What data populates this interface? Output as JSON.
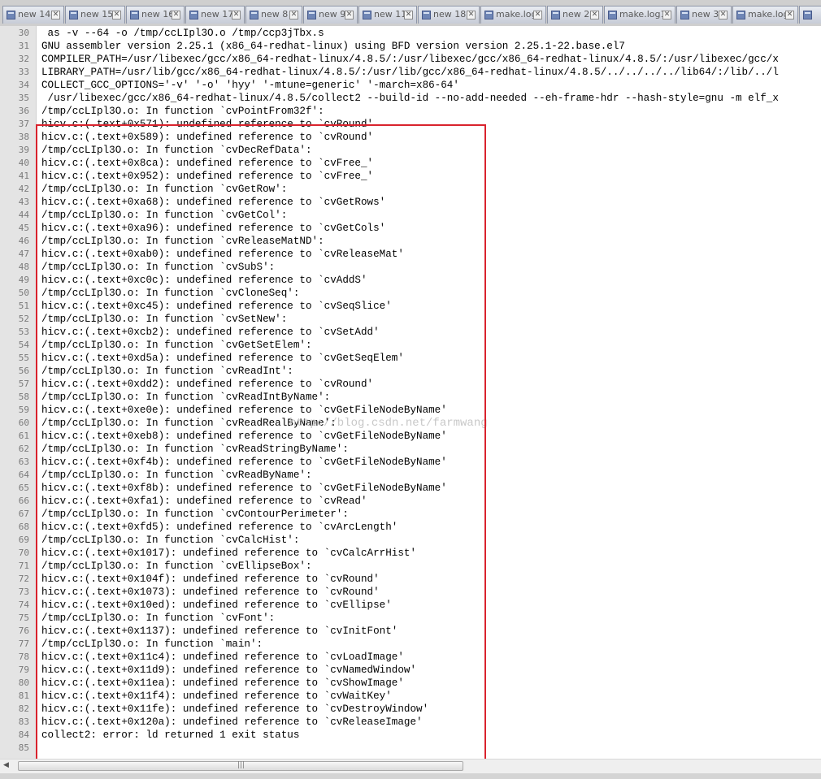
{
  "tabs": [
    {
      "label": "new 14"
    },
    {
      "label": "new 15"
    },
    {
      "label": "new 16"
    },
    {
      "label": "new 17"
    },
    {
      "label": "new 8"
    },
    {
      "label": "new 9"
    },
    {
      "label": "new 11"
    },
    {
      "label": "new 18"
    },
    {
      "label": "make.log"
    },
    {
      "label": "new 2"
    },
    {
      "label": "make.log1"
    },
    {
      "label": "new 3"
    },
    {
      "label": "make.log2"
    }
  ],
  "lines": [
    {
      "n": "30",
      "t": " as -v --64 -o /tmp/ccLIpl3O.o /tmp/ccp3jTbx.s"
    },
    {
      "n": "31",
      "t": "GNU assembler version 2.25.1 (x86_64-redhat-linux) using BFD version version 2.25.1-22.base.el7"
    },
    {
      "n": "32",
      "t": "COMPILER_PATH=/usr/libexec/gcc/x86_64-redhat-linux/4.8.5/:/usr/libexec/gcc/x86_64-redhat-linux/4.8.5/:/usr/libexec/gcc/x"
    },
    {
      "n": "33",
      "t": "LIBRARY_PATH=/usr/lib/gcc/x86_64-redhat-linux/4.8.5/:/usr/lib/gcc/x86_64-redhat-linux/4.8.5/../../../../lib64/:/lib/../l"
    },
    {
      "n": "34",
      "t": "COLLECT_GCC_OPTIONS='-v' '-o' 'hyy' '-mtune=generic' '-march=x86-64'"
    },
    {
      "n": "35",
      "t": " /usr/libexec/gcc/x86_64-redhat-linux/4.8.5/collect2 --build-id --no-add-needed --eh-frame-hdr --hash-style=gnu -m elf_x"
    },
    {
      "n": "36",
      "t": "/tmp/ccLIpl3O.o: In function `cvPointFrom32f':"
    },
    {
      "n": "37",
      "t": "hicv.c:(.text+0x571): undefined reference to `cvRound'"
    },
    {
      "n": "38",
      "t": "hicv.c:(.text+0x589): undefined reference to `cvRound'"
    },
    {
      "n": "39",
      "t": "/tmp/ccLIpl3O.o: In function `cvDecRefData':"
    },
    {
      "n": "40",
      "t": "hicv.c:(.text+0x8ca): undefined reference to `cvFree_'"
    },
    {
      "n": "41",
      "t": "hicv.c:(.text+0x952): undefined reference to `cvFree_'"
    },
    {
      "n": "42",
      "t": "/tmp/ccLIpl3O.o: In function `cvGetRow':"
    },
    {
      "n": "43",
      "t": "hicv.c:(.text+0xa68): undefined reference to `cvGetRows'"
    },
    {
      "n": "44",
      "t": "/tmp/ccLIpl3O.o: In function `cvGetCol':"
    },
    {
      "n": "45",
      "t": "hicv.c:(.text+0xa96): undefined reference to `cvGetCols'"
    },
    {
      "n": "46",
      "t": "/tmp/ccLIpl3O.o: In function `cvReleaseMatND':"
    },
    {
      "n": "47",
      "t": "hicv.c:(.text+0xab0): undefined reference to `cvReleaseMat'"
    },
    {
      "n": "48",
      "t": "/tmp/ccLIpl3O.o: In function `cvSubS':"
    },
    {
      "n": "49",
      "t": "hicv.c:(.text+0xc0c): undefined reference to `cvAddS'"
    },
    {
      "n": "50",
      "t": "/tmp/ccLIpl3O.o: In function `cvCloneSeq':"
    },
    {
      "n": "51",
      "t": "hicv.c:(.text+0xc45): undefined reference to `cvSeqSlice'"
    },
    {
      "n": "52",
      "t": "/tmp/ccLIpl3O.o: In function `cvSetNew':"
    },
    {
      "n": "53",
      "t": "hicv.c:(.text+0xcb2): undefined reference to `cvSetAdd'"
    },
    {
      "n": "54",
      "t": "/tmp/ccLIpl3O.o: In function `cvGetSetElem':"
    },
    {
      "n": "55",
      "t": "hicv.c:(.text+0xd5a): undefined reference to `cvGetSeqElem'"
    },
    {
      "n": "56",
      "t": "/tmp/ccLIpl3O.o: In function `cvReadInt':"
    },
    {
      "n": "57",
      "t": "hicv.c:(.text+0xdd2): undefined reference to `cvRound'"
    },
    {
      "n": "58",
      "t": "/tmp/ccLIpl3O.o: In function `cvReadIntByName':"
    },
    {
      "n": "59",
      "t": "hicv.c:(.text+0xe0e): undefined reference to `cvGetFileNodeByName'"
    },
    {
      "n": "60",
      "t": "/tmp/ccLIpl3O.o: In function `cvReadRealByName':"
    },
    {
      "n": "61",
      "t": "hicv.c:(.text+0xeb8): undefined reference to `cvGetFileNodeByName'"
    },
    {
      "n": "62",
      "t": "/tmp/ccLIpl3O.o: In function `cvReadStringByName':"
    },
    {
      "n": "63",
      "t": "hicv.c:(.text+0xf4b): undefined reference to `cvGetFileNodeByName'"
    },
    {
      "n": "64",
      "t": "/tmp/ccLIpl3O.o: In function `cvReadByName':"
    },
    {
      "n": "65",
      "t": "hicv.c:(.text+0xf8b): undefined reference to `cvGetFileNodeByName'"
    },
    {
      "n": "66",
      "t": "hicv.c:(.text+0xfa1): undefined reference to `cvRead'"
    },
    {
      "n": "67",
      "t": "/tmp/ccLIpl3O.o: In function `cvContourPerimeter':"
    },
    {
      "n": "68",
      "t": "hicv.c:(.text+0xfd5): undefined reference to `cvArcLength'"
    },
    {
      "n": "69",
      "t": "/tmp/ccLIpl3O.o: In function `cvCalcHist':"
    },
    {
      "n": "70",
      "t": "hicv.c:(.text+0x1017): undefined reference to `cvCalcArrHist'"
    },
    {
      "n": "71",
      "t": "/tmp/ccLIpl3O.o: In function `cvEllipseBox':"
    },
    {
      "n": "72",
      "t": "hicv.c:(.text+0x104f): undefined reference to `cvRound'"
    },
    {
      "n": "73",
      "t": "hicv.c:(.text+0x1073): undefined reference to `cvRound'"
    },
    {
      "n": "74",
      "t": "hicv.c:(.text+0x10ed): undefined reference to `cvEllipse'"
    },
    {
      "n": "75",
      "t": "/tmp/ccLIpl3O.o: In function `cvFont':"
    },
    {
      "n": "76",
      "t": "hicv.c:(.text+0x1137): undefined reference to `cvInitFont'"
    },
    {
      "n": "77",
      "t": "/tmp/ccLIpl3O.o: In function `main':"
    },
    {
      "n": "78",
      "t": "hicv.c:(.text+0x11c4): undefined reference to `cvLoadImage'"
    },
    {
      "n": "79",
      "t": "hicv.c:(.text+0x11d9): undefined reference to `cvNamedWindow'"
    },
    {
      "n": "80",
      "t": "hicv.c:(.text+0x11ea): undefined reference to `cvShowImage'"
    },
    {
      "n": "81",
      "t": "hicv.c:(.text+0x11f4): undefined reference to `cvWaitKey'"
    },
    {
      "n": "82",
      "t": "hicv.c:(.text+0x11fe): undefined reference to `cvDestroyWindow'"
    },
    {
      "n": "83",
      "t": "hicv.c:(.text+0x120a): undefined reference to `cvReleaseImage'"
    },
    {
      "n": "84",
      "t": "collect2: error: ld returned 1 exit status"
    },
    {
      "n": "85",
      "t": ""
    }
  ],
  "watermark": "http://blog.csdn.net/farmwang",
  "icons": {
    "tab_file": "file-icon",
    "tab_close": "close-icon",
    "scroll_left": "arrow-left-icon",
    "scroll_grip": "grip-icon"
  },
  "glyphs": {
    "close": "✕",
    "scroll_left": "◀",
    "scroll_grip": "|||"
  },
  "colors": {
    "highlight": "#d9232d",
    "gutter": "#e4e4e4",
    "tab_bg": "#dfe3ec"
  }
}
